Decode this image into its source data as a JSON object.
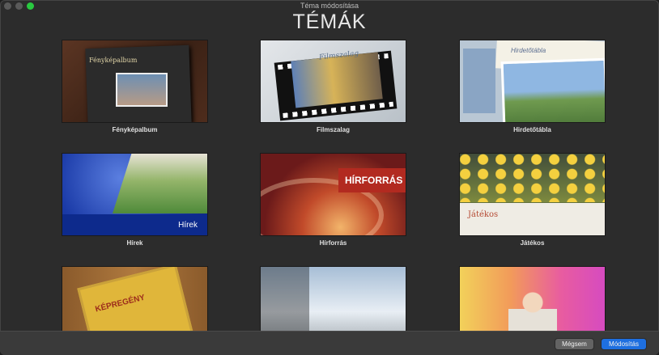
{
  "window": {
    "title": "Téma módosítása",
    "heading": "TÉMÁK"
  },
  "themes": [
    {
      "label": "Fényképalbum",
      "thumb_caption": "Fényképalbum"
    },
    {
      "label": "Filmszalag",
      "thumb_caption": "Filmszalag"
    },
    {
      "label": "Hirdetőtábla",
      "thumb_caption": "Hirdetőtábla"
    },
    {
      "label": "Hírek",
      "thumb_caption": "Hírek"
    },
    {
      "label": "Hírforrás",
      "thumb_caption": "HÍRFORRÁS"
    },
    {
      "label": "Játékos",
      "thumb_caption": "Játékos"
    },
    {
      "label": "",
      "thumb_caption": "KÉPREGÉNY"
    },
    {
      "label": "",
      "thumb_caption": ""
    },
    {
      "label": "",
      "thumb_caption": ""
    }
  ],
  "buttons": {
    "cancel": "Mégsem",
    "confirm": "Módosítás"
  },
  "colors": {
    "accent": "#1e6fe0"
  }
}
